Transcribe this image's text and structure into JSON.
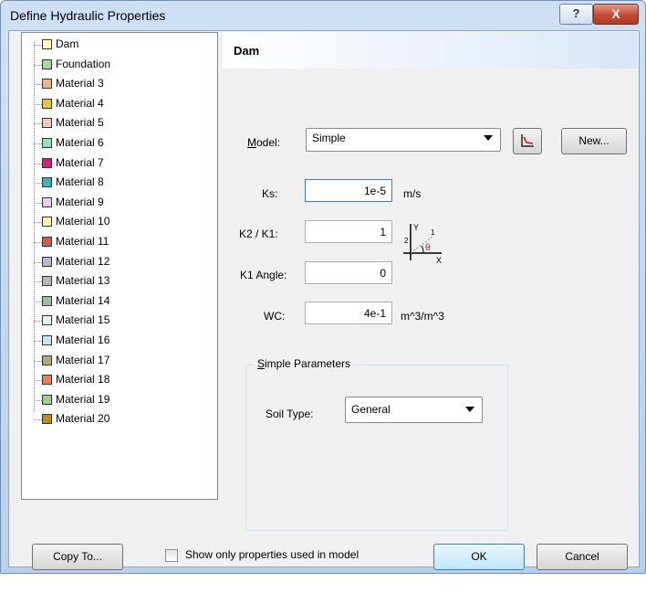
{
  "window": {
    "title": "Define Hydraulic Properties",
    "help_label": "?",
    "close_label": "X"
  },
  "tree": {
    "items": [
      {
        "label": "Dam",
        "color": "#fff9b0"
      },
      {
        "label": "Foundation",
        "color": "#a9d8a0"
      },
      {
        "label": "Material 3",
        "color": "#f5b283"
      },
      {
        "label": "Material 4",
        "color": "#f6c02f"
      },
      {
        "label": "Material 5",
        "color": "#f7c4be"
      },
      {
        "label": "Material 6",
        "color": "#8fe7b7"
      },
      {
        "label": "Material 7",
        "color": "#e0197a"
      },
      {
        "label": "Material 8",
        "color": "#31b5c4"
      },
      {
        "label": "Material 9",
        "color": "#f4c9f1"
      },
      {
        "label": "Material 10",
        "color": "#fbf6a7"
      },
      {
        "label": "Material 11",
        "color": "#d25b4e"
      },
      {
        "label": "Material 12",
        "color": "#b3b7d0"
      },
      {
        "label": "Material 13",
        "color": "#b8b8b8"
      },
      {
        "label": "Material 14",
        "color": "#9bbf9c"
      },
      {
        "label": "Material 15",
        "color": "#dff5f5"
      },
      {
        "label": "Material 16",
        "color": "#c5e6f0"
      },
      {
        "label": "Material 17",
        "color": "#b2aa7a"
      },
      {
        "label": "Material 18",
        "color": "#f07f52"
      },
      {
        "label": "Material 19",
        "color": "#9ad28a"
      },
      {
        "label": "Material 20",
        "color": "#c48a16"
      }
    ]
  },
  "detail": {
    "header": "Dam",
    "model_label": "Model:",
    "model_value": "Simple",
    "new_button": "New...",
    "ks_label": "Ks:",
    "ks_value": "1e-5",
    "ks_unit": "m/s",
    "k2k1_label": "K2 / K1:",
    "k2k1_value": "1",
    "k1angle_label": "K1 Angle:",
    "k1angle_value": "0",
    "wc_label": "WC:",
    "wc_value": "4e-1",
    "wc_unit": "m^3/m^3",
    "diagram": {
      "y": "Y",
      "x": "X",
      "one": "1",
      "two": "2",
      "theta": "θ"
    }
  },
  "simple_params": {
    "title": "Simple Parameters",
    "soil_type_label": "Soil Type:",
    "soil_type_value": "General"
  },
  "footer": {
    "copy_to": "Copy To...",
    "show_only_label": "Show only properties used in model",
    "ok": "OK",
    "cancel": "Cancel"
  }
}
